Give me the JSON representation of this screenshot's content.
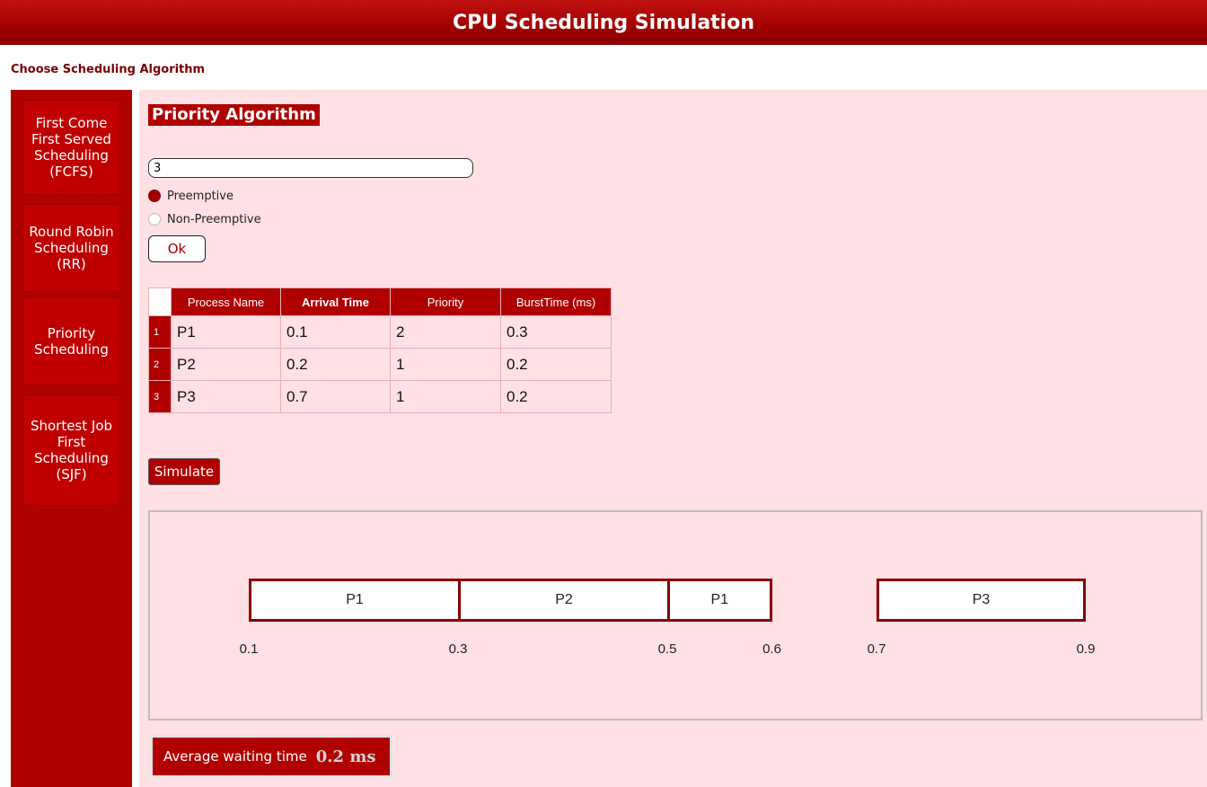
{
  "header": {
    "title": "CPU Scheduling Simulation"
  },
  "choose_label": "Choose Scheduling Algorithm",
  "sidebar": {
    "items": [
      {
        "label": "First Come First Served Scheduling (FCFS)"
      },
      {
        "label": "Round Robin Scheduling (RR)"
      },
      {
        "label": "Priority Scheduling"
      },
      {
        "label": "Shortest Job First Scheduling (SJF)"
      }
    ]
  },
  "main": {
    "algorithm_title": "Priority Algorithm",
    "process_count": "3",
    "radios": [
      {
        "label": "Preemptive",
        "checked": true
      },
      {
        "label": "Non-Preemptive",
        "checked": false
      }
    ],
    "ok_label": "Ok",
    "table": {
      "headers": [
        "Process Name",
        "Arrival Time",
        "Priority",
        "BurstTime (ms)"
      ],
      "rows": [
        {
          "num": "1",
          "cells": [
            "P1",
            "0.1",
            "2",
            "0.3"
          ]
        },
        {
          "num": "2",
          "cells": [
            "P2",
            "0.2",
            "1",
            "0.2"
          ]
        },
        {
          "num": "3",
          "cells": [
            "P3",
            "0.7",
            "1",
            "0.2"
          ]
        }
      ]
    },
    "simulate_label": "Simulate",
    "gantt": {
      "segments": [
        {
          "name": "P1",
          "start": 0.1,
          "end": 0.3
        },
        {
          "name": "P2",
          "start": 0.3,
          "end": 0.5
        },
        {
          "name": "P1",
          "start": 0.5,
          "end": 0.6
        },
        {
          "name": "P3",
          "start": 0.7,
          "end": 0.9
        }
      ],
      "ticks": [
        "0.1",
        "0.3",
        "0.5",
        "0.6",
        "0.7",
        "0.9"
      ]
    },
    "avg_label": "Average waiting time",
    "avg_value": "0.2 ms"
  },
  "colors": {
    "accent": "#b00000",
    "panel": "#ffe0e5",
    "bar_border": "#8b0000"
  }
}
